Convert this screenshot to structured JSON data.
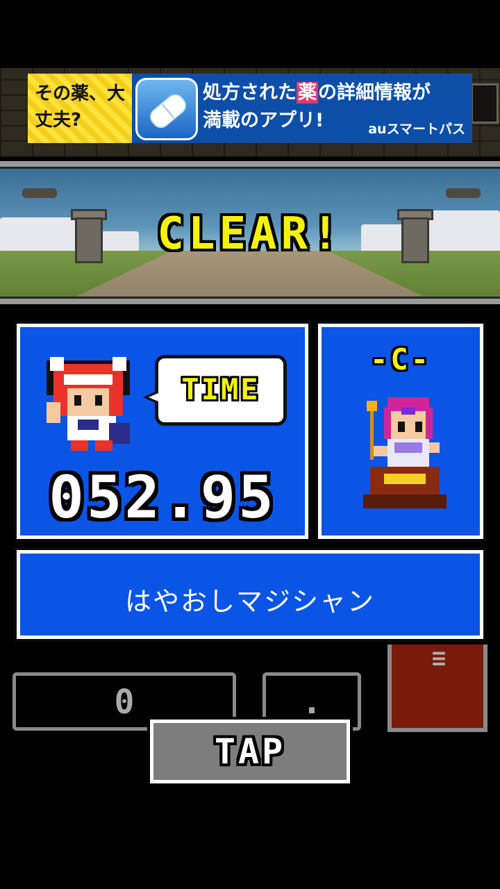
{
  "ad": {
    "left_text": "その薬、大丈夫?",
    "right_text_1": "処方された",
    "right_text_hl": "薬",
    "right_text_2": "の詳細情報が",
    "right_text_3": "満載のアプリ!",
    "brand": "auスマートパス",
    "icon": "pill-icon"
  },
  "scene": {
    "title": "CLEAR!"
  },
  "result": {
    "time_label": "TIME",
    "time_value": "052.95",
    "rank_label": "-C-",
    "title_name": "はやおしマジシャン"
  },
  "controls": {
    "left_display": "0",
    "mid_display": ".",
    "menu_icon": "≡",
    "tap_label": "TAP"
  },
  "colors": {
    "panel_blue": "#0a55e6",
    "title_yellow": "#f5f20a",
    "menu_red": "#7a1a0a"
  }
}
